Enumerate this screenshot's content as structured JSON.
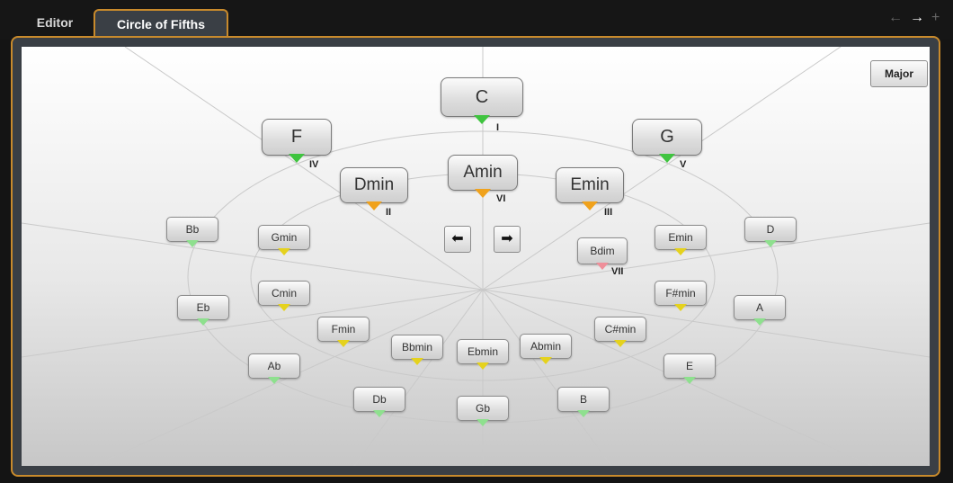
{
  "tabs": {
    "editor": "Editor",
    "circle_of_fifths": "Circle of Fifths"
  },
  "nav": {
    "back_icon": "←",
    "forward_icon": "→",
    "add_icon": "+"
  },
  "mode_button": "Major",
  "arrows": {
    "left_icon": "⬅",
    "right_icon": "➡"
  },
  "colors": {
    "accent_border": "#c88a2c",
    "green": "#3fc43f",
    "orange": "#f0a21c",
    "yellow": "#e5d21d",
    "light_green": "#8ee08e",
    "pink": "#ef8f9a"
  },
  "chords": {
    "c": {
      "label": "C",
      "degree": "I"
    },
    "f": {
      "label": "F",
      "degree": "IV"
    },
    "g": {
      "label": "G",
      "degree": "V"
    },
    "dmin": {
      "label": "Dmin",
      "degree": "II"
    },
    "amin": {
      "label": "Amin",
      "degree": "VI"
    },
    "emin_m": {
      "label": "Emin",
      "degree": "III"
    },
    "bdim": {
      "label": "Bdim",
      "degree": "VII"
    },
    "bb": {
      "label": "Bb"
    },
    "gmin": {
      "label": "Gmin"
    },
    "emin_s": {
      "label": "Emin"
    },
    "d": {
      "label": "D"
    },
    "eb": {
      "label": "Eb"
    },
    "cmin": {
      "label": "Cmin"
    },
    "fsmin": {
      "label": "F#min"
    },
    "a": {
      "label": "A"
    },
    "fmin": {
      "label": "Fmin"
    },
    "csmin": {
      "label": "C#min"
    },
    "bbmin": {
      "label": "Bbmin"
    },
    "ebmin": {
      "label": "Ebmin"
    },
    "abmin": {
      "label": "Abmin"
    },
    "ab": {
      "label": "Ab"
    },
    "e": {
      "label": "E"
    },
    "db": {
      "label": "Db"
    },
    "gb": {
      "label": "Gb"
    },
    "b": {
      "label": "B"
    }
  }
}
